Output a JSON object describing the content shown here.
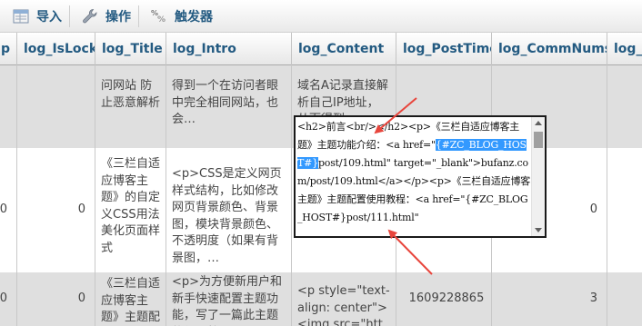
{
  "toolbar": {
    "import_label": "导入",
    "operation_label": "操作",
    "trigger_label": "触发器"
  },
  "table": {
    "columns": [
      "p",
      "log_IsLock",
      "log_Title",
      "log_Intro",
      "log_Content",
      "log_PostTime",
      "log_CommNums",
      "log_V"
    ],
    "rows": [
      {
        "id": "",
        "islock": "",
        "title": "问网站 防止恶意解析",
        "intro": "得到一个在访问者眼中完全相同网站，也会…",
        "content": "域名A记录直接解析自己IP地址，从而得到一…",
        "posttime": "",
        "commnums": "",
        "views": ""
      },
      {
        "id": "0",
        "islock": "0",
        "title": "《三栏自适应博客主题》的自定义CSS用法美化页面样式",
        "intro": "<p>CSS是定义网页样式结构，比如修改网页背景颜色、背景图，模块背景颜色、不透明度（如果有背景图，…",
        "content": "",
        "posttime": "",
        "commnums": "0",
        "views": ""
      },
      {
        "id": "0",
        "islock": "0",
        "title": "《三栏自适应博客主题》主题配置使用教程",
        "intro": "<p>为方便新用户和新手快速配置主题功能，写了一篇此主题的使用教程。</p><p>此文章不定时更新。…",
        "content": "<p style=\"text-align: center\"><img src=\"https://up…",
        "posttime": "1609228865",
        "commnums": "3",
        "views": ""
      }
    ]
  },
  "editor": {
    "before": "<h2>前言<br/></h2><p>《三栏自适应博客主题》主题功能介绍：<a href=\"",
    "selected": "{#ZC_BLOG_HOST#}",
    "after": "post/109.html\" target=\"_blank\">bufanz.com/post/109.html</a></p><p>《三栏自适应博客主题》主题配置使用教程：<a href=\"{#ZC_BLOG_HOST#}post/111.html\""
  },
  "annotation_color": "#e8453c"
}
